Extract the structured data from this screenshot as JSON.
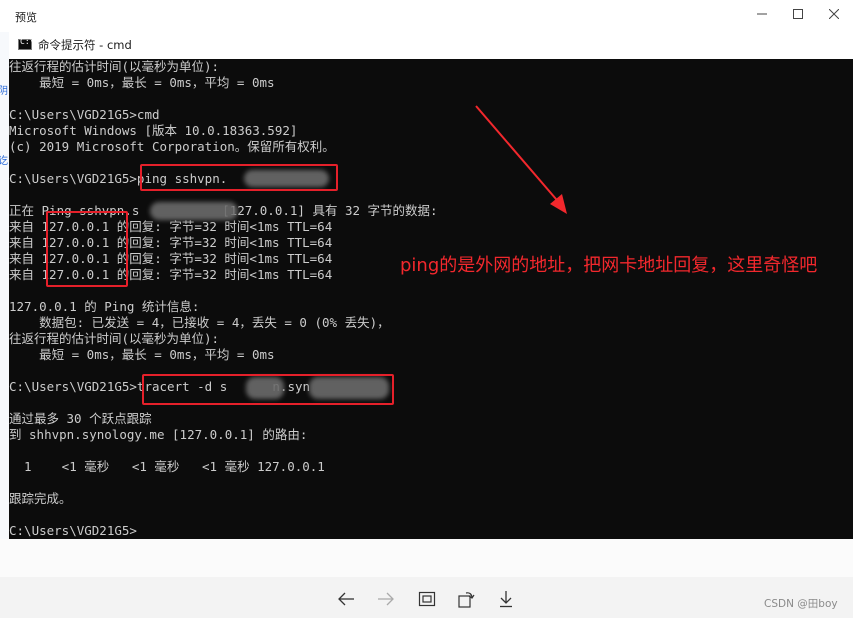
{
  "preview_window": {
    "title": "预览",
    "controls": [
      "minimize-icon",
      "maximize-icon",
      "close-icon"
    ]
  },
  "cmd_window": {
    "title": "命令提示符 - cmd",
    "icon": "cmd-icon",
    "icon_text": "C:\\"
  },
  "console": {
    "lines": [
      "往返行程的估计时间(以毫秒为单位):",
      "    最短 = 0ms，最长 = 0ms，平均 = 0ms",
      "",
      "C:\\Users\\VGD21G5>cmd",
      "Microsoft Windows [版本 10.0.18363.592]",
      "(c) 2019 Microsoft Corporation。保留所有权利。",
      "",
      "C:\\Users\\VGD21G5>ping sshvpn.",
      "",
      "正在 Ping sshvpn.s           [127.0.0.1] 具有 32 字节的数据:",
      "来自 127.0.0.1 的回复: 字节=32 时间<1ms TTL=64",
      "来自 127.0.0.1 的回复: 字节=32 时间<1ms TTL=64",
      "来自 127.0.0.1 的回复: 字节=32 时间<1ms TTL=64",
      "来自 127.0.0.1 的回复: 字节=32 时间<1ms TTL=64",
      "",
      "127.0.0.1 的 Ping 统计信息:",
      "    数据包: 已发送 = 4，已接收 = 4，丢失 = 0 (0% 丢失)，",
      "往返行程的估计时间(以毫秒为单位):",
      "    最短 = 0ms，最长 = 0ms，平均 = 0ms",
      "",
      "C:\\Users\\VGD21G5>tracert -d s      n.syn",
      "",
      "通过最多 30 个跃点跟踪",
      "到 shhvpn.synology.me [127.0.0.1] 的路由:",
      "",
      "  1    <1 毫秒   <1 毫秒   <1 毫秒 127.0.0.1",
      "",
      "跟踪完成。",
      "",
      "C:\\Users\\VGD21G5>"
    ]
  },
  "annotation": {
    "text": "ping的是外网的地址，把网卡地址回复，这里奇怪吧",
    "color": "#f2282d"
  },
  "side_glyphs": [
    "阴",
    "讫"
  ],
  "toolbar": {
    "buttons": [
      "back-arrow-icon",
      "forward-arrow-icon",
      "fit-screen-icon",
      "rotate-icon",
      "download-icon"
    ]
  },
  "watermark": "CSDN @田boy",
  "colors": {
    "console_bg": "#0c0c0c",
    "console_text": "#cccccc",
    "highlight_box": "#e5202a"
  }
}
